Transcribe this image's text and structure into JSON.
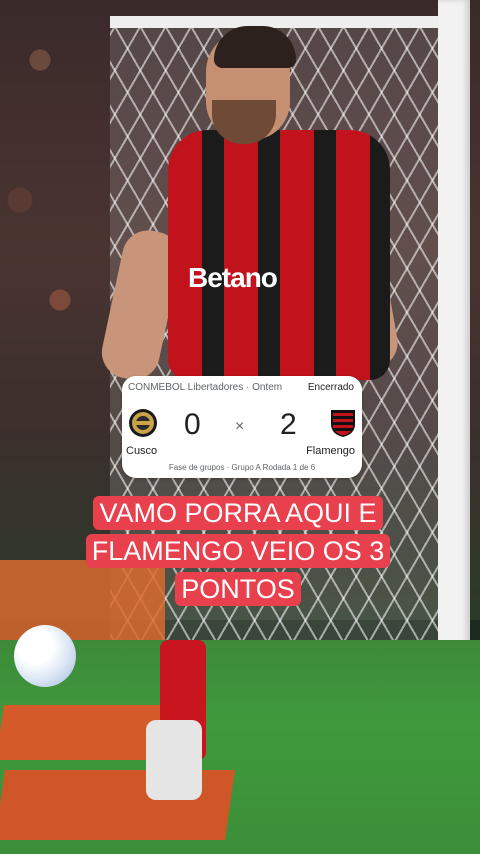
{
  "score_card": {
    "competition": "CONMEBOL Libertadores · Ontem",
    "status": "Encerrado",
    "home_team": "Cusco",
    "away_team": "Flamengo",
    "home_score": "0",
    "away_score": "2",
    "separator": "×",
    "round_info": "Fase de grupos · Grupo A   Rodada 1 de 6"
  },
  "caption": {
    "text": "VAMO PORRA AQUI E FLAMENGO VEIO OS 3 PONTOS",
    "background_color": "#e8404c",
    "text_color": "#ffffff"
  },
  "photo": {
    "sponsor_text": "Betano"
  },
  "colors": {
    "flamengo_red": "#c2121c",
    "flamengo_black": "#1b1b1b",
    "cusco_gold": "#c9a24a"
  }
}
